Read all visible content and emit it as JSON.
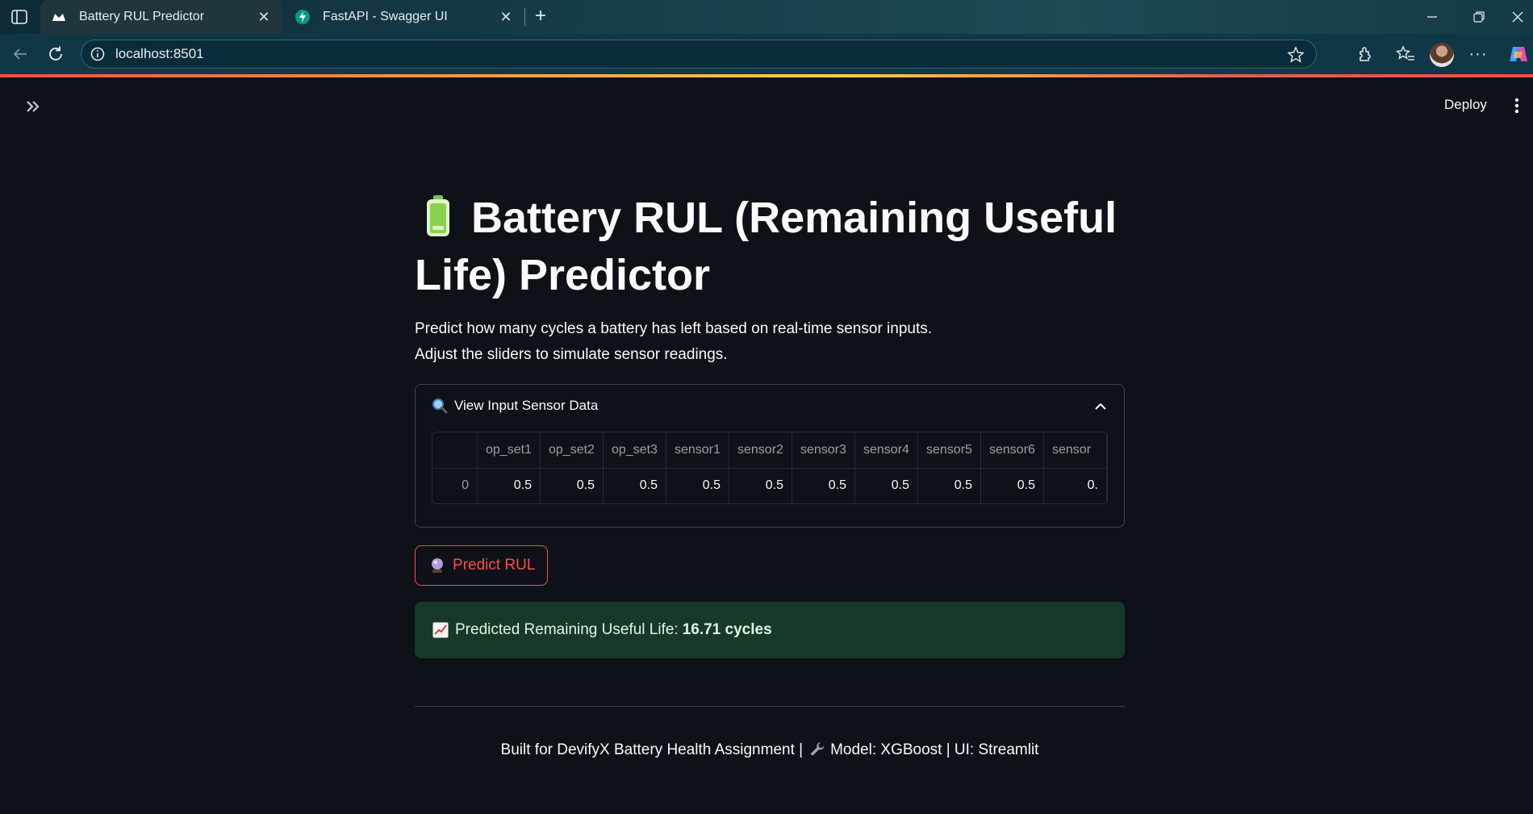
{
  "browser": {
    "tabs": [
      {
        "title": "Battery RUL Predictor",
        "active": true
      },
      {
        "title": "FastAPI - Swagger UI",
        "active": false
      }
    ],
    "url": "localhost:8501"
  },
  "app": {
    "deploy_label": "Deploy",
    "title": "Battery RUL (Remaining Useful Life) Predictor",
    "description_line1": "Predict how many cycles a battery has left based on real-time sensor inputs.",
    "description_line2": "Adjust the sliders to simulate sensor readings.",
    "expander": {
      "label": "View Input Sensor Data",
      "columns": [
        "op_set1",
        "op_set2",
        "op_set3",
        "sensor1",
        "sensor2",
        "sensor3",
        "sensor4",
        "sensor5",
        "sensor6",
        "sensor"
      ],
      "row_index": "0",
      "row_values": [
        "0.5",
        "0.5",
        "0.5",
        "0.5",
        "0.5",
        "0.5",
        "0.5",
        "0.5",
        "0.5",
        "0."
      ]
    },
    "predict_button_label": "Predict RUL",
    "result": {
      "prefix": "Predicted Remaining Useful Life:",
      "value": "16.71 cycles"
    },
    "footer": {
      "part1": "Built for DevifyX Battery Health Assignment |",
      "part2": "Model: XGBoost | UI: Streamlit"
    }
  },
  "colors": {
    "accent": "#ff4b4b",
    "success_bg": "#173928",
    "app_bg": "#0e1117"
  }
}
